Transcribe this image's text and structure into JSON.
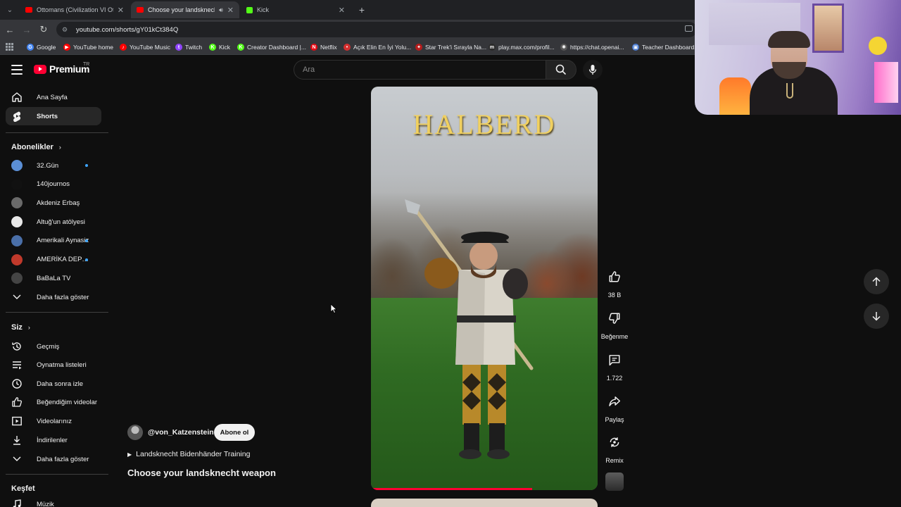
{
  "browser": {
    "tabs": [
      {
        "title": "Ottomans (Civilization VI Ottoman",
        "favicon": "youtube",
        "active": false
      },
      {
        "title": "Choose your landsknecht w",
        "favicon": "youtube",
        "active": true
      },
      {
        "title": "Kick",
        "favicon": "kick",
        "active": false
      }
    ],
    "url": "youtube.com/shorts/gY01kCt384Q",
    "bookmarks": [
      {
        "label": "Google",
        "color": "#4285f4",
        "glyph": "G"
      },
      {
        "label": "YouTube home",
        "color": "#ff0000",
        "glyph": "▶"
      },
      {
        "label": "YouTube Music",
        "color": "#ff0000",
        "glyph": "♪"
      },
      {
        "label": "Twitch",
        "color": "#9146ff",
        "glyph": "t"
      },
      {
        "label": "Kick",
        "color": "#53fc18",
        "glyph": "K"
      },
      {
        "label": "Creator Dashboard |...",
        "color": "#53fc18",
        "glyph": "K"
      },
      {
        "label": "Netflix",
        "color": "#e50914",
        "glyph": "N"
      },
      {
        "label": "Açık Elin En İyi Yolu...",
        "color": "#d32f2f",
        "glyph": "•"
      },
      {
        "label": "Star Trek'i Sırayla Na...",
        "color": "#b71c1c",
        "glyph": "✦"
      },
      {
        "label": "play.max.com/profil...",
        "color": "#2b2b2b",
        "glyph": "m"
      },
      {
        "label": "https://chat.openai...",
        "color": "#555555",
        "glyph": "✺"
      },
      {
        "label": "Teacher Dashboard...",
        "color": "#4a7bd0",
        "glyph": "▣"
      }
    ]
  },
  "youtube": {
    "logo_text": "Premium",
    "region": "TR",
    "search_placeholder": "Ara"
  },
  "sidebar": {
    "main": [
      {
        "label": "Ana Sayfa",
        "icon": "home-icon"
      },
      {
        "label": "Shorts",
        "icon": "shorts-icon",
        "active": true
      }
    ],
    "subscriptions_title": "Abonelikler",
    "subscriptions": [
      {
        "label": "32.Gün",
        "color": "#5b8fd6",
        "new": true
      },
      {
        "label": "140journos",
        "color": "#111111",
        "new": false
      },
      {
        "label": "Akdeniz Erbaş",
        "color": "#6a6a6a",
        "new": false
      },
      {
        "label": "Altuğ'un atölyesi",
        "color": "#e8e8e8",
        "new": false
      },
      {
        "label": "Amerikali Aynasiz",
        "color": "#4a6fa8",
        "new": true
      },
      {
        "label": "AMERİKA DEPO ...",
        "color": "#c0392b",
        "new": true
      },
      {
        "label": "BaBaLa TV",
        "color": "#444444",
        "new": false
      }
    ],
    "show_more": "Daha fazla göster",
    "you_title": "Siz",
    "you": [
      {
        "label": "Geçmiş",
        "icon": "history-icon"
      },
      {
        "label": "Oynatma listeleri",
        "icon": "playlists-icon"
      },
      {
        "label": "Daha sonra izle",
        "icon": "watch-later-icon"
      },
      {
        "label": "Beğendiğim videolar",
        "icon": "liked-icon"
      },
      {
        "label": "Videolarınız",
        "icon": "your-videos-icon"
      },
      {
        "label": "İndirilenler",
        "icon": "downloads-icon"
      }
    ],
    "show_more_2": "Daha fazla göster",
    "explore_title": "Keşfet",
    "explore": [
      {
        "label": "Müzik",
        "icon": "music-icon"
      }
    ]
  },
  "short": {
    "overlay_title": "HALBERD",
    "channel": "@von_Katzenstein",
    "subscribe": "Abone ol",
    "sound": "Landsknecht Bidenhänder Training",
    "title": "Choose your landsknecht weapon",
    "progress": 0.71,
    "likes": "38 B",
    "dislike_label": "Beğenme",
    "comments": "1.722",
    "share_label": "Paylaş",
    "remix_label": "Remix"
  }
}
